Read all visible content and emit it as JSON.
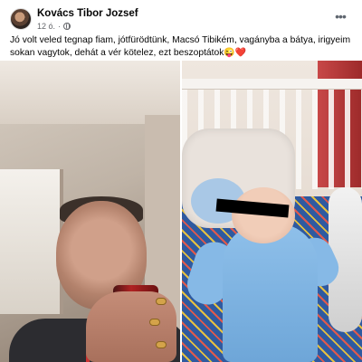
{
  "post": {
    "author": "Kovács Tibor Jozsef",
    "time": "12 ó.",
    "privacy_icon": "globe-icon",
    "more_icon": "more-horizontal-icon",
    "text": "Jó volt veled tegnap fiam, jótfürödtünk,  Macsó Tibikém, vagányba a bátya, irigyeim sokan vagytok, dehát a vér kötelez, ezt beszoptátok",
    "emoji_1": "😜",
    "emoji_2": "❤️"
  },
  "photos": [
    {
      "name": "selfie-man-with-can"
    },
    {
      "name": "baby-in-crib"
    }
  ],
  "colors": {
    "text": "#050505",
    "meta": "#65676b",
    "background": "#ffffff"
  }
}
